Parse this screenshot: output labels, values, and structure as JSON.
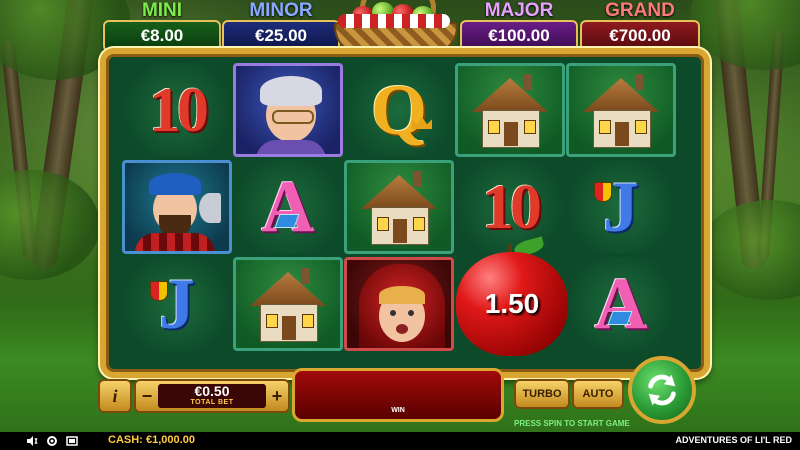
{
  "jackpots": [
    {
      "label": "MINI",
      "value": "€8.00"
    },
    {
      "label": "MINOR",
      "value": "€25.00"
    },
    {
      "label": "MAJOR",
      "value": "€100.00"
    },
    {
      "label": "GRAND",
      "value": "€700.00"
    }
  ],
  "reels": {
    "symbols": [
      [
        "10",
        "grandmother",
        "Q",
        "cottage",
        "cottage"
      ],
      [
        "lumberjack",
        "A",
        "cottage",
        "10",
        "J"
      ],
      [
        "J",
        "cottage",
        "little-red",
        "apple-bonus",
        "A"
      ]
    ],
    "text": {
      "ten": "10",
      "queen": "Q",
      "ace": "A",
      "jack": "J"
    },
    "apple_prize": "1.50"
  },
  "controls": {
    "info_label": "i",
    "minus_label": "−",
    "plus_label": "+",
    "bet_value": "€0.50",
    "bet_label": "TOTAL BET",
    "win_label": "WIN",
    "turbo_label": "TURBO",
    "auto_label": "AUTO",
    "spin_hint": "PRESS SPIN TO START GAME"
  },
  "status": {
    "cash_label": "CASH:",
    "cash_value": "€1,000.00",
    "game_title": "ADVENTURES OF LI'L RED"
  },
  "icons": [
    "sound-icon",
    "settings-icon",
    "fullscreen-icon",
    "spin-icon"
  ],
  "colors": {
    "frame_gold": "#d9a632",
    "win_red": "#a10a0a",
    "spin_green": "#2a9a34"
  }
}
